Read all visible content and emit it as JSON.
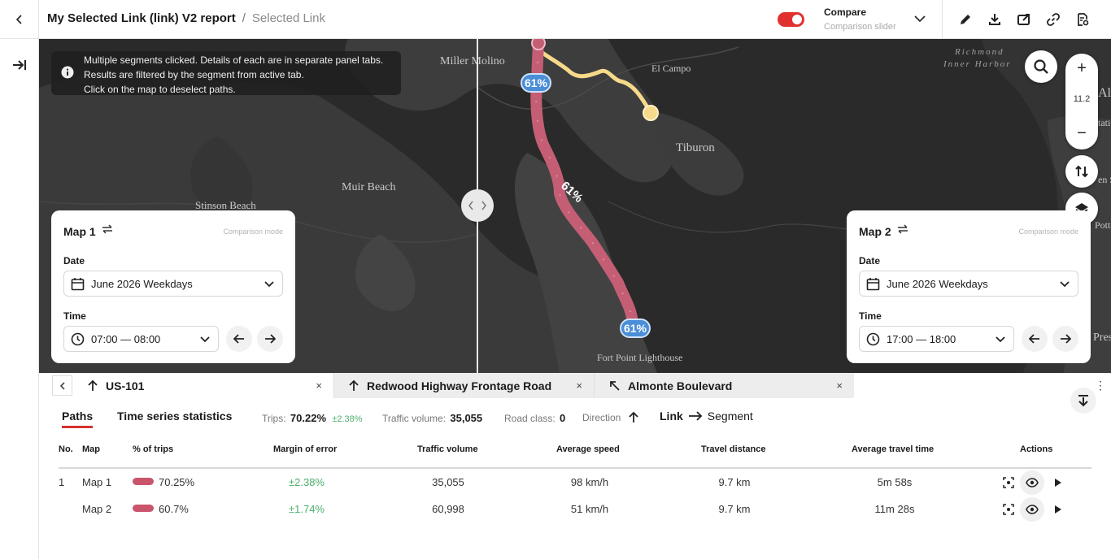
{
  "header": {
    "title": "My Selected Link (link) V2 report",
    "separator": "/",
    "subtitle": "Selected Link",
    "compare_label": "Compare",
    "compare_sub": "Comparison slider",
    "compare_enabled": true,
    "accent_color": "#e0312f",
    "tools": [
      "pencil-icon",
      "download-icon",
      "share-window-icon",
      "link-icon",
      "report-settings-icon"
    ]
  },
  "map": {
    "info_lines": [
      "Multiple segments clicked. Details of each are in separate panel tabs.",
      "Results are filtered by the segment from active tab.",
      "Click on the map to deselect paths."
    ],
    "zoom_level": "11.2",
    "zoom_in": "+",
    "zoom_out": "−",
    "places": {
      "miller": "Miller Molino",
      "elcampo": "El Campo",
      "richmond1": "Richmond",
      "richmond2": "Inner Harbor",
      "tiburon": "Tiburon",
      "muir": "Muir Beach",
      "stinson": "Stinson Beach",
      "fortpoint": "Fort Point Lighthouse",
      "al": "Al",
      "tati": "tati",
      "en": "en S",
      "potte": "Potte",
      "pres": "Pres"
    },
    "badges": [
      "61%",
      "61%"
    ],
    "route_label": "61%"
  },
  "panel1": {
    "title": "Map 1",
    "mode": "Comparison mode",
    "date_label": "Date",
    "date_value": "June 2026 Weekdays",
    "time_label": "Time",
    "time_value": "07:00 — 08:00"
  },
  "panel2": {
    "title": "Map 2",
    "mode": "Comparison mode",
    "date_label": "Date",
    "date_value": "June 2026 Weekdays",
    "time_label": "Time",
    "time_value": "17:00 — 18:00"
  },
  "segment_tabs": [
    {
      "label": "US-101",
      "close": "×"
    },
    {
      "label": "Redwood Highway Frontage Road",
      "close": "×"
    },
    {
      "label": "Almonte Boulevard",
      "close": "×"
    }
  ],
  "subtabs": {
    "paths": "Paths",
    "timeseries": "Time series statistics"
  },
  "stats": {
    "trips_label": "Trips:",
    "trips_value": "70.22%",
    "trips_err": "±2.38%",
    "volume_label": "Traffic volume:",
    "volume_value": "35,055",
    "road_label": "Road class:",
    "road_value": "0",
    "direction_label": "Direction",
    "link_label": "Link",
    "segment_label": "Segment"
  },
  "table": {
    "headers": [
      "No.",
      "Map",
      "% of trips",
      "Margin of error",
      "Traffic volume",
      "Average speed",
      "Travel distance",
      "Average travel time",
      "Actions"
    ],
    "rows": [
      {
        "no": "1",
        "map": "Map 1",
        "trips": "70.25%",
        "err": "±2.38%",
        "volume": "35,055",
        "speed": "98 km/h",
        "distance": "9.7 km",
        "time": "5m 58s"
      },
      {
        "no": "",
        "map": "Map 2",
        "trips": "60.7%",
        "err": "±1.74%",
        "volume": "60,998",
        "speed": "51 km/h",
        "distance": "9.7 km",
        "time": "11m 28s"
      }
    ]
  }
}
